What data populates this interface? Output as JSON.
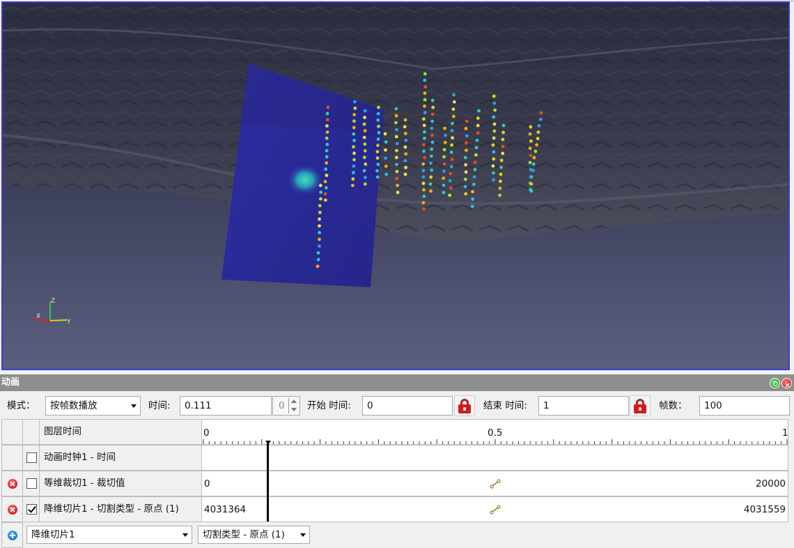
{
  "colors": {
    "viewport_border": "#3a3ad8",
    "slice_plane": "#2a2aa0",
    "panel_title_bar": "#8e8e8e",
    "lock_red": "#d01c1c"
  },
  "viewport": {
    "axes": {
      "z": "Z",
      "x": "X",
      "y": "Y"
    }
  },
  "panel": {
    "title": "动画"
  },
  "toolbar": {
    "mode_label": "模式：",
    "mode_value": "按帧数播放",
    "time_label": "时间:",
    "time_value": "0.111",
    "time_spin_value": "0",
    "start_label": "开始 时间:",
    "start_value": "0",
    "end_label": "结束 时间:",
    "end_value": "1",
    "frames_label": "帧数：",
    "frames_value": "100",
    "lock_icon": "lock-icon"
  },
  "timeline": {
    "header_label": "图层时间",
    "scale_start": "0",
    "scale_mid": "0.5",
    "scale_end": "1",
    "current_time": 0.111
  },
  "tracks": [
    {
      "name": "动画时钟1 - 时间",
      "checked": false,
      "removable": false,
      "start_value": "",
      "end_value": ""
    },
    {
      "name": "等维裁切1 - 裁切值",
      "checked": false,
      "removable": true,
      "start_value": "0",
      "end_value": "20000"
    },
    {
      "name": "降维切片1 - 切割类型 - 原点 (1)",
      "checked": true,
      "removable": true,
      "start_value": "4031364",
      "end_value": "4031559"
    }
  ],
  "add_row": {
    "source_value": "降维切片1",
    "property_value": "切割类型 - 原点 (1)"
  }
}
